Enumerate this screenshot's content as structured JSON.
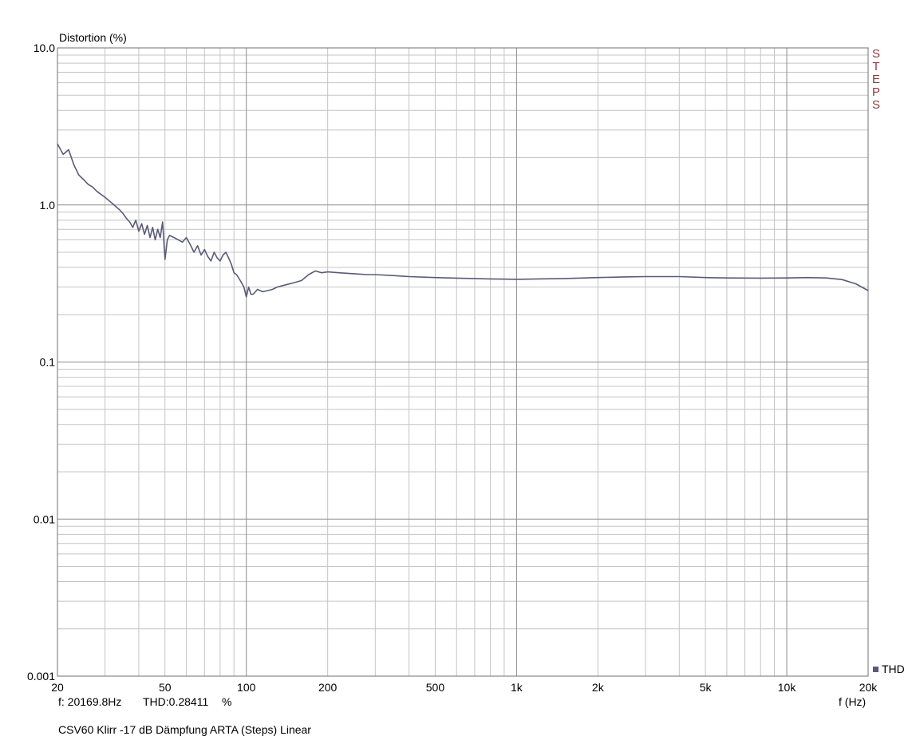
{
  "chart_data": {
    "type": "line",
    "title": "",
    "ylabel": "Distortion (%)",
    "xlabel": "f (Hz)",
    "x_scale": "log",
    "y_scale": "log",
    "xlim": [
      20,
      20000
    ],
    "ylim": [
      0.001,
      10
    ],
    "x_ticks": [
      {
        "value": 20,
        "label": "20"
      },
      {
        "value": 50,
        "label": "50"
      },
      {
        "value": 100,
        "label": "100"
      },
      {
        "value": 200,
        "label": "200"
      },
      {
        "value": 500,
        "label": "500"
      },
      {
        "value": 1000,
        "label": "1k"
      },
      {
        "value": 2000,
        "label": "2k"
      },
      {
        "value": 5000,
        "label": "5k"
      },
      {
        "value": 10000,
        "label": "10k"
      },
      {
        "value": 20000,
        "label": "20k"
      }
    ],
    "y_ticks": [
      {
        "value": 10,
        "label": "10.0"
      },
      {
        "value": 1,
        "label": "1.0"
      },
      {
        "value": 0.1,
        "label": "0.1"
      },
      {
        "value": 0.01,
        "label": "0.01"
      },
      {
        "value": 0.001,
        "label": "0.001"
      }
    ],
    "grid": true,
    "legend_position": "bottom-right",
    "series": [
      {
        "name": "THD",
        "color": "#5a5a78",
        "x": [
          20,
          21,
          22,
          23,
          24,
          25,
          26,
          27,
          28,
          30,
          32,
          34,
          35,
          36,
          37,
          38,
          39,
          40,
          41,
          42,
          43,
          44,
          45,
          46,
          47,
          48,
          49,
          50,
          51,
          52,
          54,
          56,
          58,
          60,
          62,
          64,
          66,
          68,
          70,
          72,
          74,
          76,
          78,
          80,
          82,
          84,
          86,
          88,
          90,
          92,
          95,
          98,
          100,
          102,
          104,
          106,
          110,
          115,
          120,
          125,
          130,
          140,
          150,
          160,
          170,
          180,
          190,
          200,
          220,
          250,
          280,
          300,
          350,
          400,
          500,
          600,
          700,
          800,
          1000,
          1200,
          1500,
          2000,
          2500,
          3000,
          4000,
          5000,
          6000,
          8000,
          10000,
          12000,
          14000,
          16000,
          18000,
          20000
        ],
        "values": [
          2.45,
          2.1,
          2.25,
          1.8,
          1.55,
          1.45,
          1.35,
          1.3,
          1.22,
          1.12,
          1.02,
          0.93,
          0.88,
          0.82,
          0.78,
          0.72,
          0.8,
          0.68,
          0.76,
          0.65,
          0.74,
          0.62,
          0.72,
          0.6,
          0.7,
          0.62,
          0.78,
          0.45,
          0.6,
          0.64,
          0.62,
          0.6,
          0.58,
          0.62,
          0.56,
          0.5,
          0.55,
          0.48,
          0.52,
          0.47,
          0.44,
          0.5,
          0.46,
          0.44,
          0.48,
          0.5,
          0.46,
          0.42,
          0.37,
          0.36,
          0.33,
          0.3,
          0.26,
          0.3,
          0.27,
          0.27,
          0.29,
          0.28,
          0.285,
          0.29,
          0.3,
          0.31,
          0.32,
          0.33,
          0.36,
          0.38,
          0.37,
          0.375,
          0.37,
          0.365,
          0.36,
          0.36,
          0.355,
          0.35,
          0.345,
          0.342,
          0.34,
          0.338,
          0.336,
          0.338,
          0.34,
          0.345,
          0.348,
          0.35,
          0.35,
          0.345,
          0.343,
          0.342,
          0.343,
          0.345,
          0.343,
          0.335,
          0.315,
          0.285
        ]
      }
    ]
  },
  "steps_label": "STEPS",
  "legend_label": "THD",
  "cursor_freq": "f: 20169.8Hz",
  "cursor_thd": "THD:0.28411",
  "cursor_unit": "%",
  "caption": "CSV60 Klirr -17 dB Dämpfung ARTA (Steps) Linear"
}
